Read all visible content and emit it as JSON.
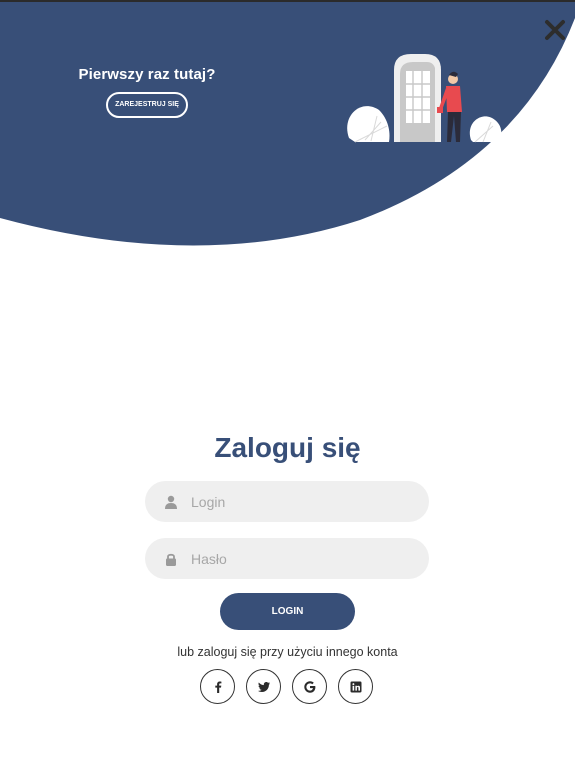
{
  "banner": {
    "title": "Pierwszy raz tutaj?",
    "signup_label": "ZAREJESTRUJ SIĘ",
    "close_icon": "close-icon",
    "color": "#384f78"
  },
  "login": {
    "title": "Zaloguj się",
    "login_placeholder": "Login",
    "password_placeholder": "Hasło",
    "submit_label": "LOGIN",
    "alt_text": "lub zaloguj się przy użyciu innego konta"
  },
  "socials": [
    {
      "name": "facebook",
      "icon": "facebook-icon"
    },
    {
      "name": "twitter",
      "icon": "twitter-icon"
    },
    {
      "name": "google",
      "icon": "google-icon"
    },
    {
      "name": "linkedin",
      "icon": "linkedin-icon"
    }
  ],
  "colors": {
    "accent": "#384f78",
    "field_bg": "#efefef",
    "accent_person": "#e84a4f"
  }
}
